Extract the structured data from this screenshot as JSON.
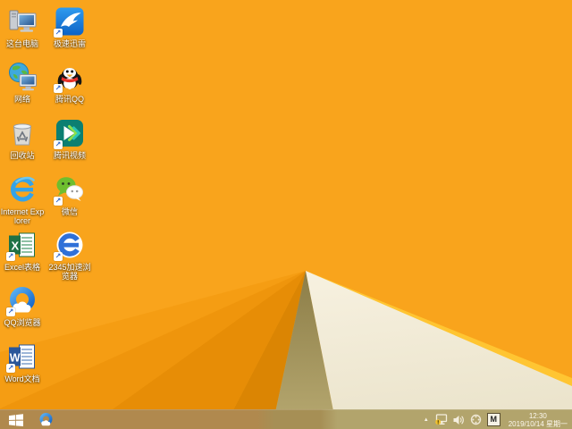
{
  "wallpaper": {
    "description": "windows-8.1-default-orange-fold",
    "base_color": "#F9A41C",
    "fold_shadow_color": "#A2945C",
    "fold_cream_color": "#F2ECD8",
    "fold_edge_color": "#FFC532"
  },
  "desktop": {
    "icons": [
      {
        "name": "this-pc",
        "label": "这台电脑",
        "shortcut": false
      },
      {
        "name": "xunlei-thunder",
        "label": "极速迅雷",
        "shortcut": true
      },
      {
        "name": "network",
        "label": "网络",
        "shortcut": false
      },
      {
        "name": "tencent-qq",
        "label": "腾讯QQ",
        "shortcut": true
      },
      {
        "name": "recycle-bin",
        "label": "回收站",
        "shortcut": false
      },
      {
        "name": "tencent-video",
        "label": "腾讯视频",
        "shortcut": true
      },
      {
        "name": "internet-explorer",
        "label": "Internet Explorer",
        "shortcut": false
      },
      {
        "name": "wechat",
        "label": "微信",
        "shortcut": true
      },
      {
        "name": "excel",
        "label": "Excel表格",
        "shortcut": true
      },
      {
        "name": "2345-browser",
        "label": "2345加速浏览器",
        "shortcut": true
      },
      {
        "name": "qq-browser",
        "label": "QQ浏览器",
        "shortcut": true
      },
      {
        "name": "word",
        "label": "Word文档",
        "shortcut": true
      }
    ]
  },
  "taskbar": {
    "pinned": [
      "start",
      "qq-browser"
    ],
    "tray_icons": [
      "show-hidden-icons",
      "network-status-warning",
      "volume",
      "utility",
      "input-method"
    ],
    "input_method_label": "M",
    "clock": {
      "time": "12:30",
      "date": "2019/10/14 星期一"
    }
  },
  "colors": {
    "taskbar_left": "#B0894E",
    "taskbar_right": "#B2A46C",
    "icon_label_text": "#FFFFFF",
    "clock_text": "#FCF8EE"
  }
}
